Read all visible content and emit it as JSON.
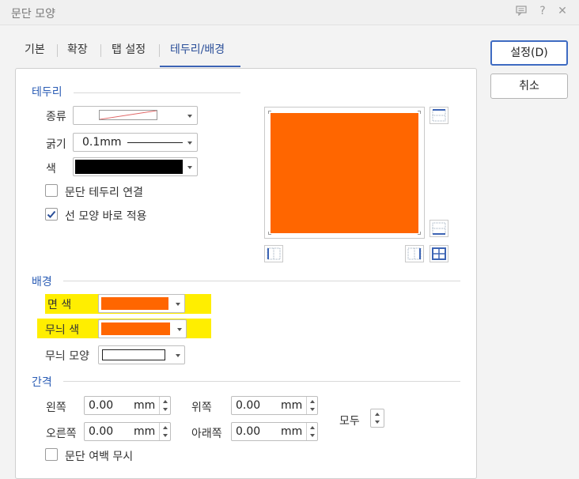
{
  "window": {
    "title": "문단 모양"
  },
  "tabs": [
    {
      "label": "기본"
    },
    {
      "label": "확장"
    },
    {
      "label": "탭 설정"
    },
    {
      "label": "테두리/배경"
    }
  ],
  "buttons": {
    "ok": "설정(D)",
    "cancel": "취소"
  },
  "border": {
    "section_title": "테두리",
    "type_label": "종류",
    "width_label": "굵기",
    "width_value": "0.1mm",
    "color_label": "색",
    "color_value": "#000000",
    "connect_label": "문단 테두리 연결",
    "connect_checked": false,
    "apply_label": "선 모양 바로 적용",
    "apply_checked": true
  },
  "preview": {
    "fill_color": "#ff6600"
  },
  "background": {
    "section_title": "배경",
    "face_color_label": "면 색",
    "face_color": "#ff6600",
    "pattern_color_label": "무늬 색",
    "pattern_color": "#ff6600",
    "pattern_shape_label": "무늬 모양",
    "highlight_color": "#ffee00"
  },
  "spacing": {
    "section_title": "간격",
    "left_label": "왼쪽",
    "left_value": "0.00",
    "top_label": "위쪽",
    "top_value": "0.00",
    "right_label": "오른쪽",
    "right_value": "0.00",
    "bottom_label": "아래쪽",
    "bottom_value": "0.00",
    "unit": "mm",
    "all_label": "모두",
    "ignore_margin_label": "문단 여백 무시",
    "ignore_margin_checked": false
  }
}
